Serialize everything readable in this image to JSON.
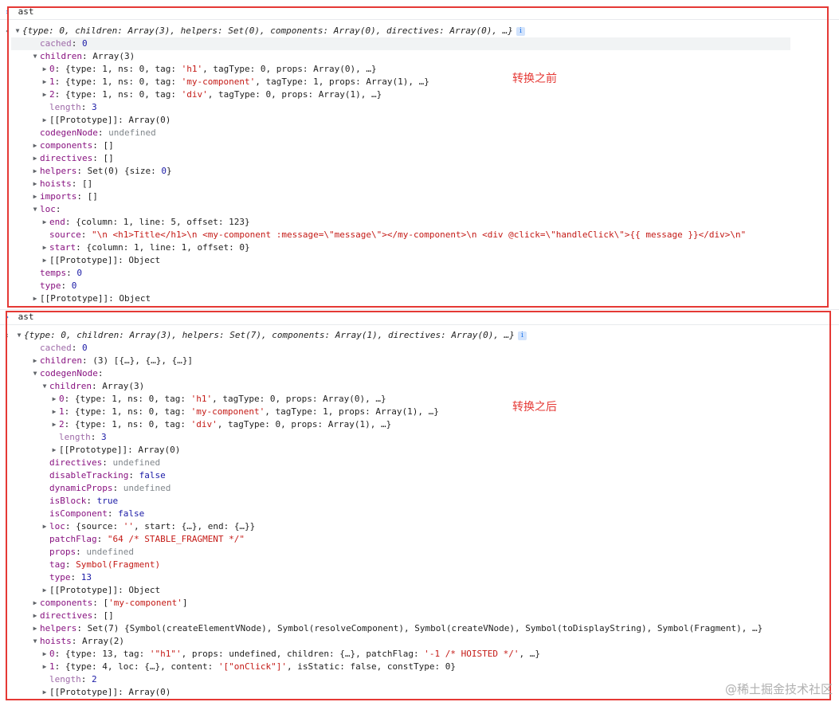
{
  "panel1": {
    "cmd": "ast",
    "summary": "{type: 0, children: Array(3), helpers: Set(0), components: Array(0), directives: Array(0), …}",
    "note": "转换之前",
    "lines": [
      {
        "ind": 2,
        "tri": "",
        "hl": true,
        "segs": [
          [
            "kp",
            "cached"
          ],
          [
            "v",
            ": "
          ],
          [
            "n",
            "0"
          ]
        ]
      },
      {
        "ind": 2,
        "tri": "▼",
        "segs": [
          [
            "k",
            "children"
          ],
          [
            "v",
            ": Array(3)"
          ]
        ]
      },
      {
        "ind": 3,
        "tri": "▶",
        "segs": [
          [
            "k",
            "0"
          ],
          [
            "v",
            ": {type: 1, ns: 0, tag: "
          ],
          [
            "s",
            "'h1'"
          ],
          [
            "v",
            ", tagType: 0, props: Array(0), …}"
          ]
        ]
      },
      {
        "ind": 3,
        "tri": "▶",
        "segs": [
          [
            "k",
            "1"
          ],
          [
            "v",
            ": {type: 1, ns: 0, tag: "
          ],
          [
            "s",
            "'my-component'"
          ],
          [
            "v",
            ", tagType: 1, props: Array(1), …}"
          ]
        ]
      },
      {
        "ind": 3,
        "tri": "▶",
        "segs": [
          [
            "k",
            "2"
          ],
          [
            "v",
            ": {type: 1, ns: 0, tag: "
          ],
          [
            "s",
            "'div'"
          ],
          [
            "v",
            ", tagType: 0, props: Array(1), …}"
          ]
        ]
      },
      {
        "ind": 3,
        "tri": "",
        "segs": [
          [
            "kp",
            "length"
          ],
          [
            "v",
            ": "
          ],
          [
            "n",
            "3"
          ]
        ]
      },
      {
        "ind": 3,
        "tri": "▶",
        "segs": [
          [
            "v",
            "[[Prototype]]: Array(0)"
          ]
        ]
      },
      {
        "ind": 2,
        "tri": "",
        "segs": [
          [
            "k",
            "codegenNode"
          ],
          [
            "v",
            ": "
          ],
          [
            "u",
            "undefined"
          ]
        ]
      },
      {
        "ind": 2,
        "tri": "▶",
        "segs": [
          [
            "k",
            "components"
          ],
          [
            "v",
            ": []"
          ]
        ]
      },
      {
        "ind": 2,
        "tri": "▶",
        "segs": [
          [
            "k",
            "directives"
          ],
          [
            "v",
            ": []"
          ]
        ]
      },
      {
        "ind": 2,
        "tri": "▶",
        "segs": [
          [
            "k",
            "helpers"
          ],
          [
            "v",
            ": Set(0) {size: "
          ],
          [
            "n",
            "0"
          ],
          [
            "v",
            "}"
          ]
        ]
      },
      {
        "ind": 2,
        "tri": "▶",
        "segs": [
          [
            "k",
            "hoists"
          ],
          [
            "v",
            ": []"
          ]
        ]
      },
      {
        "ind": 2,
        "tri": "▶",
        "segs": [
          [
            "k",
            "imports"
          ],
          [
            "v",
            ": []"
          ]
        ]
      },
      {
        "ind": 2,
        "tri": "▼",
        "segs": [
          [
            "k",
            "loc"
          ],
          [
            "v",
            ":"
          ]
        ]
      },
      {
        "ind": 3,
        "tri": "▶",
        "segs": [
          [
            "k",
            "end"
          ],
          [
            "v",
            ": {column: 1, line: 5, offset: 123}"
          ]
        ]
      },
      {
        "ind": 3,
        "tri": "",
        "segs": [
          [
            "k",
            "source"
          ],
          [
            "v",
            ": "
          ],
          [
            "s",
            "\"\\n    <h1>Title</h1>\\n    <my-component :message=\\\"message\\\"></my-component>\\n    <div @click=\\\"handleClick\\\">{{ message }}</div>\\n\""
          ]
        ]
      },
      {
        "ind": 3,
        "tri": "▶",
        "segs": [
          [
            "k",
            "start"
          ],
          [
            "v",
            ": {column: 1, line: 1, offset: 0}"
          ]
        ]
      },
      {
        "ind": 3,
        "tri": "▶",
        "segs": [
          [
            "v",
            "[[Prototype]]: Object"
          ]
        ]
      },
      {
        "ind": 2,
        "tri": "",
        "segs": [
          [
            "k",
            "temps"
          ],
          [
            "v",
            ": "
          ],
          [
            "n",
            "0"
          ]
        ]
      },
      {
        "ind": 2,
        "tri": "",
        "segs": [
          [
            "k",
            "type"
          ],
          [
            "v",
            ": "
          ],
          [
            "n",
            "0"
          ]
        ]
      },
      {
        "ind": 2,
        "tri": "▶",
        "segs": [
          [
            "v",
            "[[Prototype]]: Object"
          ]
        ]
      }
    ]
  },
  "panel2": {
    "cmd": "ast",
    "summary": "{type: 0, children: Array(3), helpers: Set(7), components: Array(1), directives: Array(0), …}",
    "note": "转换之后",
    "lines": [
      {
        "ind": 2,
        "tri": "",
        "segs": [
          [
            "kp",
            "cached"
          ],
          [
            "v",
            ": "
          ],
          [
            "n",
            "0"
          ]
        ]
      },
      {
        "ind": 2,
        "tri": "▶",
        "segs": [
          [
            "k",
            "children"
          ],
          [
            "v",
            ": (3) [{…}, {…}, {…}]"
          ]
        ]
      },
      {
        "ind": 2,
        "tri": "▼",
        "segs": [
          [
            "k",
            "codegenNode"
          ],
          [
            "v",
            ":"
          ]
        ]
      },
      {
        "ind": 3,
        "tri": "▼",
        "segs": [
          [
            "k",
            "children"
          ],
          [
            "v",
            ": Array(3)"
          ]
        ]
      },
      {
        "ind": 4,
        "tri": "▶",
        "segs": [
          [
            "k",
            "0"
          ],
          [
            "v",
            ": {type: 1, ns: 0, tag: "
          ],
          [
            "s",
            "'h1'"
          ],
          [
            "v",
            ", tagType: 0, props: Array(0), …}"
          ]
        ]
      },
      {
        "ind": 4,
        "tri": "▶",
        "segs": [
          [
            "k",
            "1"
          ],
          [
            "v",
            ": {type: 1, ns: 0, tag: "
          ],
          [
            "s",
            "'my-component'"
          ],
          [
            "v",
            ", tagType: 1, props: Array(1), …}"
          ]
        ]
      },
      {
        "ind": 4,
        "tri": "▶",
        "segs": [
          [
            "k",
            "2"
          ],
          [
            "v",
            ": {type: 1, ns: 0, tag: "
          ],
          [
            "s",
            "'div'"
          ],
          [
            "v",
            ", tagType: 0, props: Array(1), …}"
          ]
        ]
      },
      {
        "ind": 4,
        "tri": "",
        "segs": [
          [
            "kp",
            "length"
          ],
          [
            "v",
            ": "
          ],
          [
            "n",
            "3"
          ]
        ]
      },
      {
        "ind": 4,
        "tri": "▶",
        "segs": [
          [
            "v",
            "[[Prototype]]: Array(0)"
          ]
        ]
      },
      {
        "ind": 3,
        "tri": "",
        "segs": [
          [
            "k",
            "directives"
          ],
          [
            "v",
            ": "
          ],
          [
            "u",
            "undefined"
          ]
        ]
      },
      {
        "ind": 3,
        "tri": "",
        "segs": [
          [
            "k",
            "disableTracking"
          ],
          [
            "v",
            ": "
          ],
          [
            "b",
            "false"
          ]
        ]
      },
      {
        "ind": 3,
        "tri": "",
        "segs": [
          [
            "k",
            "dynamicProps"
          ],
          [
            "v",
            ": "
          ],
          [
            "u",
            "undefined"
          ]
        ]
      },
      {
        "ind": 3,
        "tri": "",
        "segs": [
          [
            "k",
            "isBlock"
          ],
          [
            "v",
            ": "
          ],
          [
            "b",
            "true"
          ]
        ]
      },
      {
        "ind": 3,
        "tri": "",
        "segs": [
          [
            "k",
            "isComponent"
          ],
          [
            "v",
            ": "
          ],
          [
            "b",
            "false"
          ]
        ]
      },
      {
        "ind": 3,
        "tri": "▶",
        "segs": [
          [
            "k",
            "loc"
          ],
          [
            "v",
            ": {source: "
          ],
          [
            "s",
            "''"
          ],
          [
            "v",
            ", start: {…}, end: {…}}"
          ]
        ]
      },
      {
        "ind": 3,
        "tri": "",
        "segs": [
          [
            "k",
            "patchFlag"
          ],
          [
            "v",
            ": "
          ],
          [
            "s",
            "\"64 /* STABLE_FRAGMENT */\""
          ]
        ]
      },
      {
        "ind": 3,
        "tri": "",
        "segs": [
          [
            "k",
            "props"
          ],
          [
            "v",
            ": "
          ],
          [
            "u",
            "undefined"
          ]
        ]
      },
      {
        "ind": 3,
        "tri": "",
        "segs": [
          [
            "k",
            "tag"
          ],
          [
            "v",
            ": "
          ],
          [
            "sym",
            "Symbol(Fragment)"
          ]
        ]
      },
      {
        "ind": 3,
        "tri": "",
        "segs": [
          [
            "k",
            "type"
          ],
          [
            "v",
            ": "
          ],
          [
            "n",
            "13"
          ]
        ]
      },
      {
        "ind": 3,
        "tri": "▶",
        "segs": [
          [
            "v",
            "[[Prototype]]: Object"
          ]
        ]
      },
      {
        "ind": 2,
        "tri": "▶",
        "segs": [
          [
            "k",
            "components"
          ],
          [
            "v",
            ": ["
          ],
          [
            "s",
            "'my-component'"
          ],
          [
            "v",
            "]"
          ]
        ]
      },
      {
        "ind": 2,
        "tri": "▶",
        "segs": [
          [
            "k",
            "directives"
          ],
          [
            "v",
            ": []"
          ]
        ]
      },
      {
        "ind": 2,
        "tri": "▶",
        "segs": [
          [
            "k",
            "helpers"
          ],
          [
            "v",
            ": Set(7) {Symbol(createElementVNode), Symbol(resolveComponent), Symbol(createVNode), Symbol(toDisplayString), Symbol(Fragment), …}"
          ]
        ]
      },
      {
        "ind": 2,
        "tri": "▼",
        "segs": [
          [
            "k",
            "hoists"
          ],
          [
            "v",
            ": Array(2)"
          ]
        ]
      },
      {
        "ind": 3,
        "tri": "▶",
        "segs": [
          [
            "k",
            "0"
          ],
          [
            "v",
            ": {type: 13, tag: "
          ],
          [
            "s",
            "'\"h1\"'"
          ],
          [
            "v",
            ", props: undefined, children: {…}, patchFlag: "
          ],
          [
            "s",
            "'-1 /* HOISTED */'"
          ],
          [
            "v",
            ", …}"
          ]
        ]
      },
      {
        "ind": 3,
        "tri": "▶",
        "segs": [
          [
            "k",
            "1"
          ],
          [
            "v",
            ": {type: 4, loc: {…}, content: "
          ],
          [
            "s",
            "'[\"onClick\"]'"
          ],
          [
            "v",
            ", isStatic: false, constType: 0}"
          ]
        ]
      },
      {
        "ind": 3,
        "tri": "",
        "segs": [
          [
            "kp",
            "length"
          ],
          [
            "v",
            ": "
          ],
          [
            "n",
            "2"
          ]
        ]
      },
      {
        "ind": 3,
        "tri": "▶",
        "segs": [
          [
            "v",
            "[[Prototype]]: Array(0)"
          ]
        ]
      }
    ]
  },
  "watermark": "@稀土掘金技术社区"
}
